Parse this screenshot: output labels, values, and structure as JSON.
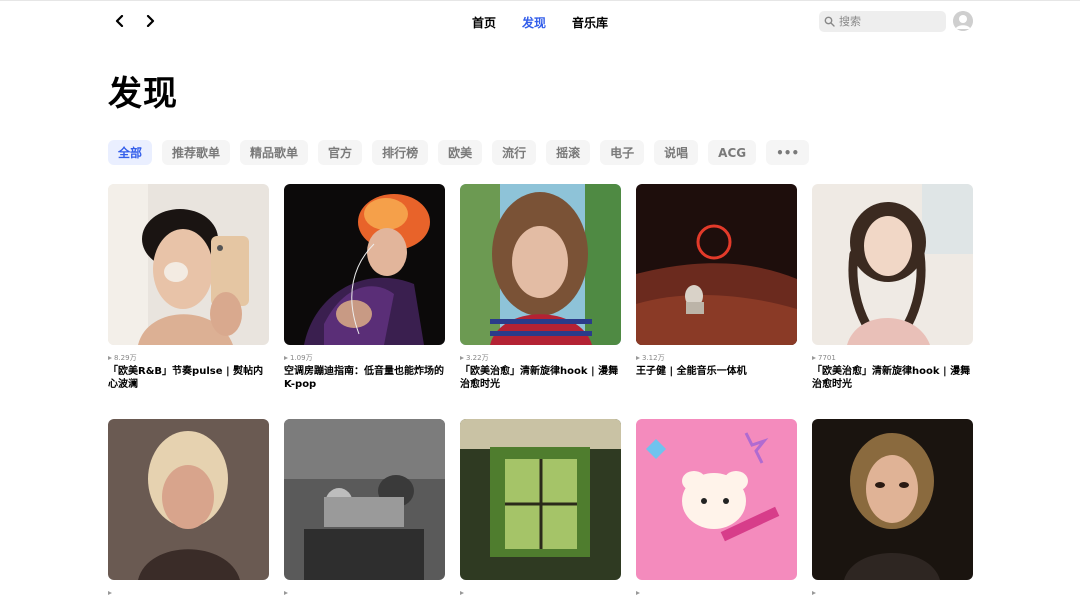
{
  "nav": {
    "back_icon": "chevron-left-icon",
    "forward_icon": "chevron-right-icon",
    "tabs": [
      {
        "label": "首页",
        "active": false
      },
      {
        "label": "发现",
        "active": true
      },
      {
        "label": "音乐库",
        "active": false
      }
    ],
    "search_placeholder": "搜索",
    "accent_color": "#335eea"
  },
  "page": {
    "title": "发现"
  },
  "categories": [
    {
      "label": "全部",
      "active": true
    },
    {
      "label": "推荐歌单",
      "active": false
    },
    {
      "label": "精品歌单",
      "active": false
    },
    {
      "label": "官方",
      "active": false
    },
    {
      "label": "排行榜",
      "active": false
    },
    {
      "label": "欧美",
      "active": false
    },
    {
      "label": "流行",
      "active": false
    },
    {
      "label": "摇滚",
      "active": false
    },
    {
      "label": "电子",
      "active": false
    },
    {
      "label": "说唱",
      "active": false
    },
    {
      "label": "ACG",
      "active": false
    },
    {
      "label": "•••",
      "active": false
    }
  ],
  "playlists": [
    {
      "plays": "8.29万",
      "title": "「欧美R&B」节奏pulse | 熨帖内心波澜"
    },
    {
      "plays": "1.09万",
      "title": "空调房蹦迪指南：低音量也能炸场的K-pop"
    },
    {
      "plays": "3.22万",
      "title": "「欧美治愈」清新旋律hook | 漫舞治愈时光"
    },
    {
      "plays": "3.12万",
      "title": "王子健 | 全能音乐一体机"
    },
    {
      "plays": "7701",
      "title": "「欧美治愈」清新旋律hook | 漫舞治愈时光"
    },
    {
      "plays": "",
      "title": ""
    },
    {
      "plays": "",
      "title": ""
    },
    {
      "plays": "",
      "title": ""
    },
    {
      "plays": "",
      "title": ""
    },
    {
      "plays": "",
      "title": ""
    }
  ]
}
